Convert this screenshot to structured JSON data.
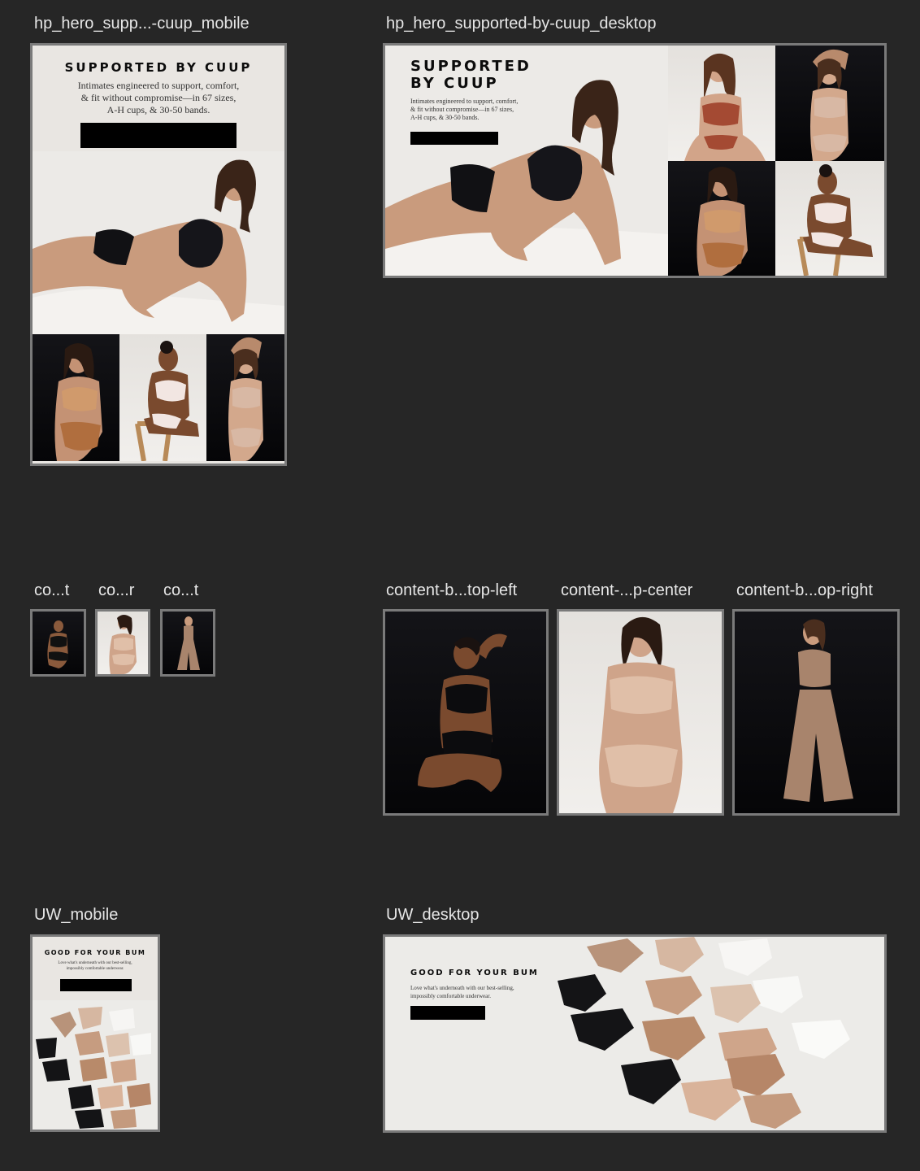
{
  "artboards": {
    "hero_mobile": {
      "label": "hp_hero_supp...-cuup_mobile",
      "headline": "SUPPORTED BY CUUP",
      "subtext": "Intimates engineered to support, comfort,\n& fit without compromise—in 67 sizes,\nA-H cups, & 30-50 bands."
    },
    "hero_desktop": {
      "label": "hp_hero_supported-by-cuup_desktop",
      "headline_line1": "SUPPORTED",
      "headline_line2": "BY CUUP",
      "subtext": "Intimates engineered to support, comfort,\n& fit without compromise—in 67 sizes,\nA-H cups, & 30-50 bands."
    },
    "thumb_1": {
      "label": "co...t"
    },
    "thumb_2": {
      "label": "co...r"
    },
    "thumb_3": {
      "label": "co...t"
    },
    "cb_top_left": {
      "label": "content-b...top-left"
    },
    "cb_top_center": {
      "label": "content-...p-center"
    },
    "cb_top_right": {
      "label": "content-b...op-right"
    },
    "uw_mobile": {
      "label": "UW_mobile",
      "headline": "GOOD FOR YOUR BUM",
      "subtext": "Love what's underneath with our best-selling,\nimpossibly comfortable underwear."
    },
    "uw_desktop": {
      "label": "UW_desktop",
      "headline": "GOOD FOR YOUR BUM",
      "subtext": "Love what's underneath with our best-selling,\nimpossibly comfortable underwear."
    }
  },
  "colors": {
    "canvas": "#262626",
    "frame_border": "#7a7a7a",
    "studio_light": "#e9e6e2",
    "studio_dark": "#0b0b0d",
    "skin": "#c99b7d",
    "terracotta": "#a44a33",
    "nude": "#d7b49c",
    "cta": "#000000"
  }
}
